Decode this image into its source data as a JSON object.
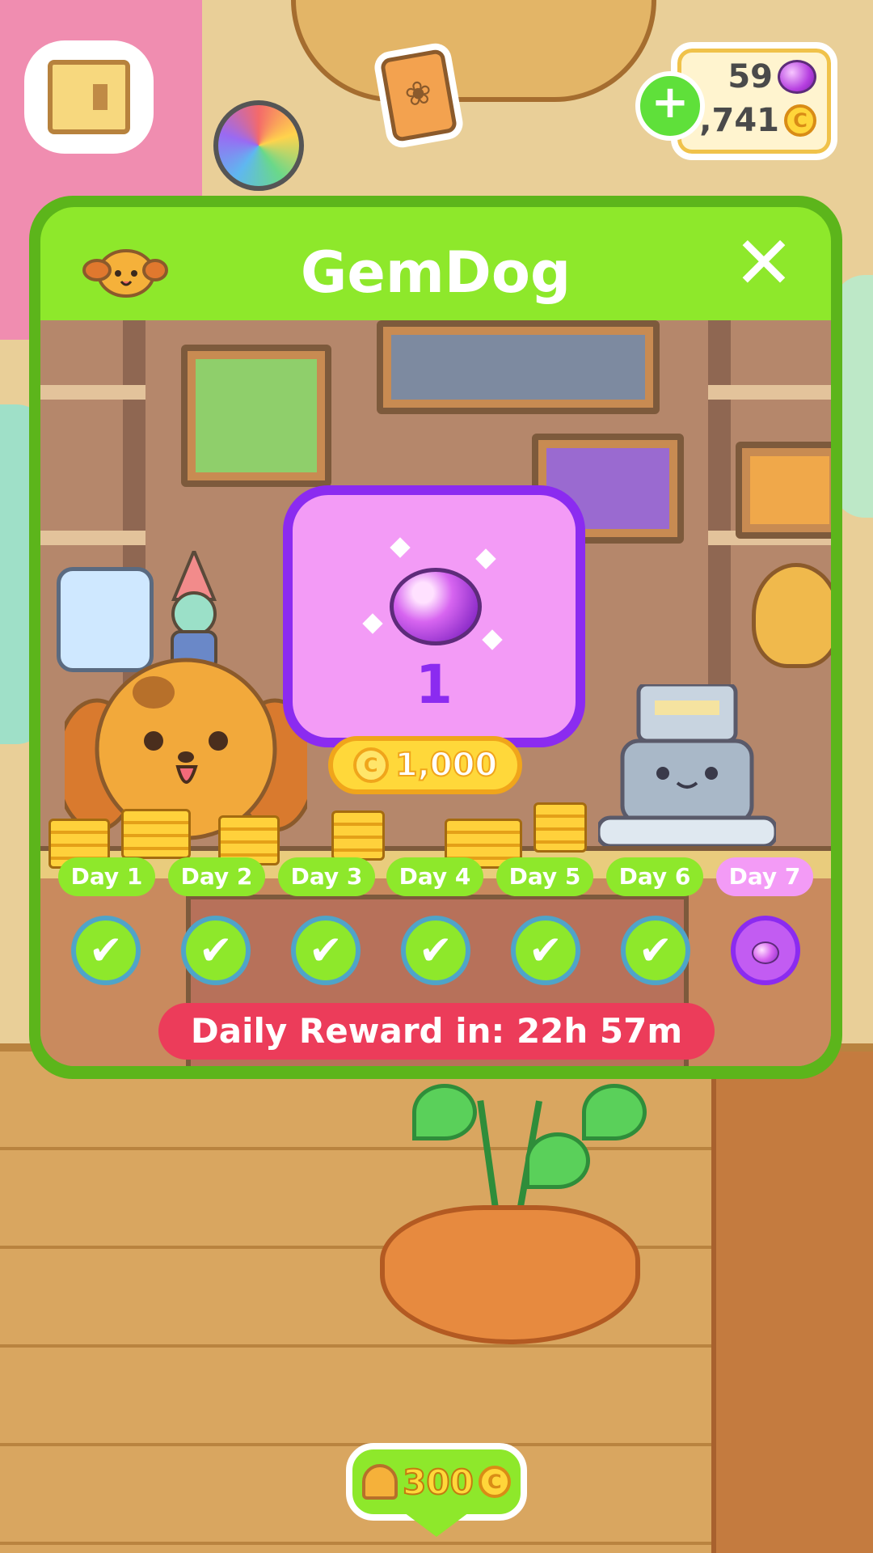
{
  "hud": {
    "gems": "59",
    "coins": "8,741",
    "coin_symbol": "C",
    "plus_symbol": "+"
  },
  "modal": {
    "title": "GemDog",
    "close_symbol": "✕",
    "reward": {
      "amount": "1",
      "item_icon": "gem-icon",
      "price": "1,000",
      "coin_symbol": "C"
    },
    "days": [
      {
        "label": "Day 1",
        "claimed": true,
        "mark": "✔"
      },
      {
        "label": "Day 2",
        "claimed": true,
        "mark": "✔"
      },
      {
        "label": "Day 3",
        "claimed": true,
        "mark": "✔"
      },
      {
        "label": "Day 4",
        "claimed": true,
        "mark": "✔"
      },
      {
        "label": "Day 5",
        "claimed": true,
        "mark": "✔"
      },
      {
        "label": "Day 6",
        "claimed": true,
        "mark": "✔"
      },
      {
        "label": "Day 7",
        "claimed": false,
        "mark": ""
      }
    ],
    "timer": "Daily Reward in: 22h 57m"
  },
  "bell_button": {
    "cost": "300",
    "coin_symbol": "C"
  },
  "colors": {
    "accent_green": "#8ee82b",
    "gem_purple": "#8b2bf0",
    "timer_red": "#ec3c5a",
    "coin_gold": "#ffd83a"
  }
}
